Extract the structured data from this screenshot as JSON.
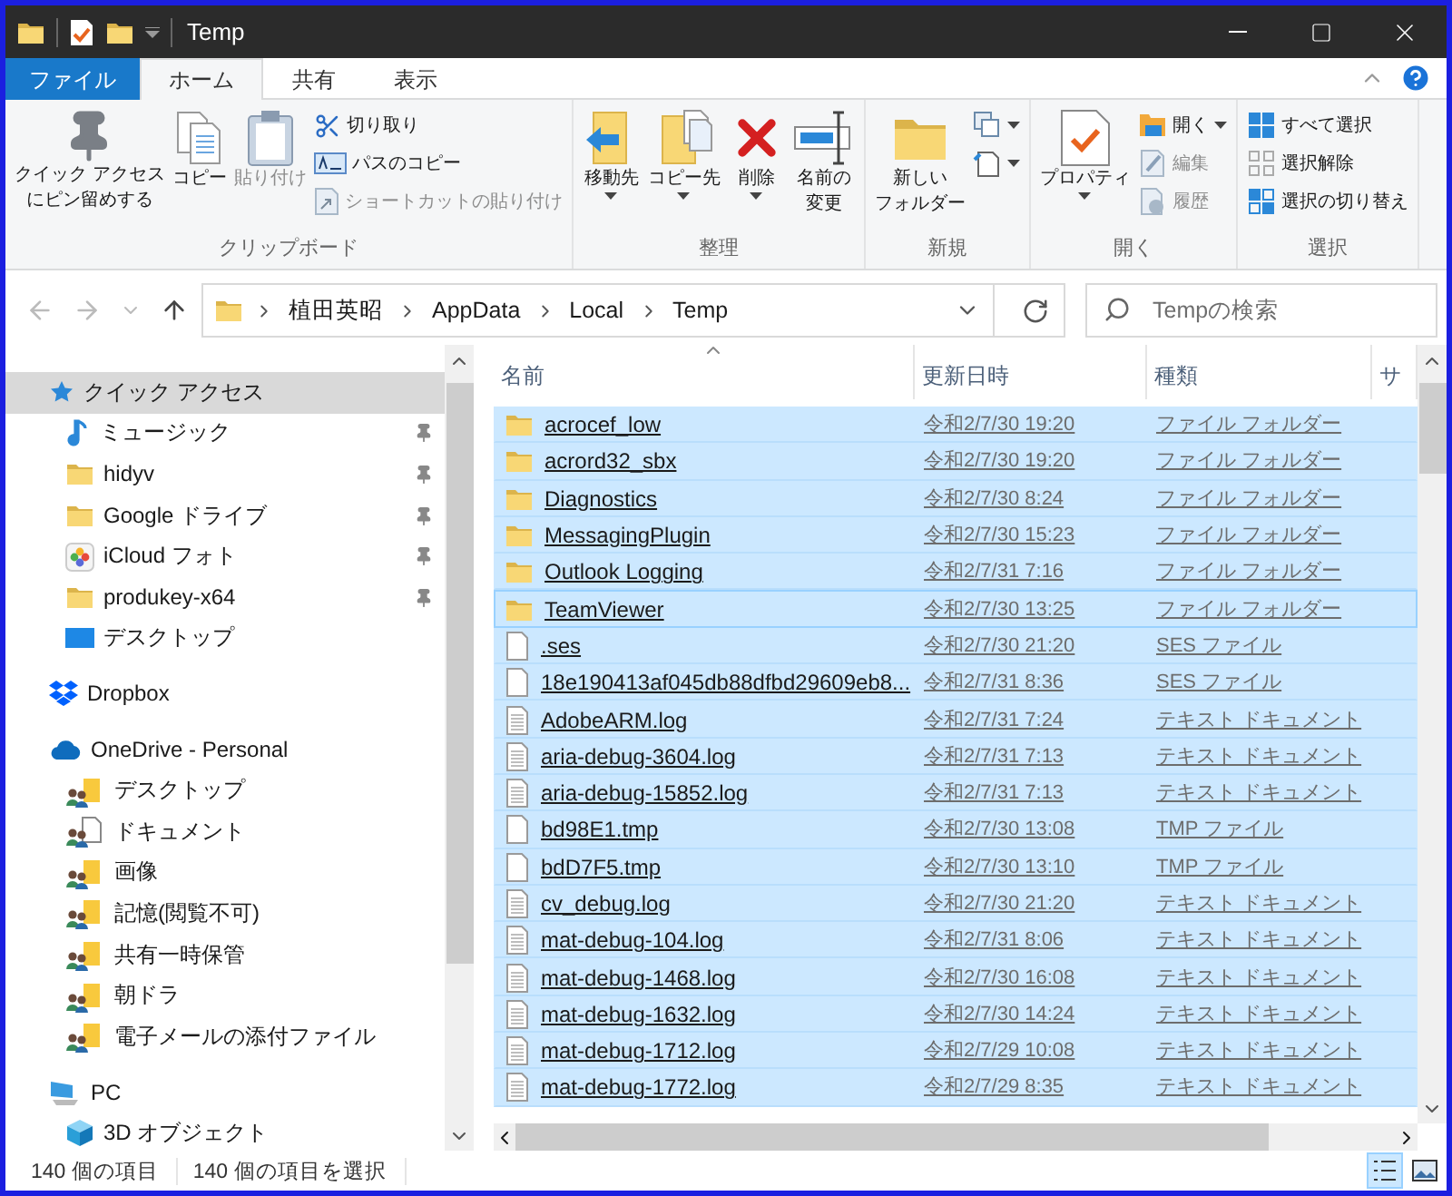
{
  "window": {
    "title": "Temp"
  },
  "ribbon_tabs": [
    {
      "label": "ファイル",
      "kind": "file",
      "selected": false
    },
    {
      "label": "ホーム",
      "kind": "tab",
      "selected": true
    },
    {
      "label": "共有",
      "kind": "tab",
      "selected": false
    },
    {
      "label": "表示",
      "kind": "tab",
      "selected": false
    }
  ],
  "ribbon_groups": [
    {
      "label": "クリップボード",
      "items": [
        {
          "kind": "large",
          "lines": [
            "クイック アクセス",
            "にピン留めする"
          ],
          "disabled": false,
          "dropdown": false
        },
        {
          "kind": "large",
          "lines": [
            "コピー"
          ],
          "disabled": false,
          "dropdown": false
        },
        {
          "kind": "large",
          "lines": [
            "貼り付け"
          ],
          "disabled": true,
          "dropdown": false
        },
        {
          "kind": "small",
          "label": "切り取り",
          "disabled": false,
          "dropdown": false
        },
        {
          "kind": "small",
          "label": "パスのコピー",
          "disabled": false,
          "dropdown": false
        },
        {
          "kind": "small",
          "label": "ショートカットの貼り付け",
          "disabled": true,
          "dropdown": false
        }
      ]
    },
    {
      "label": "整理",
      "items": [
        {
          "kind": "large",
          "lines": [
            "移動先"
          ],
          "disabled": false,
          "dropdown": true
        },
        {
          "kind": "large",
          "lines": [
            "コピー先"
          ],
          "disabled": false,
          "dropdown": true
        },
        {
          "kind": "large",
          "lines": [
            "削除"
          ],
          "disabled": false,
          "dropdown": true
        },
        {
          "kind": "large",
          "lines": [
            "名前の",
            "変更"
          ],
          "disabled": false,
          "dropdown": false
        }
      ]
    },
    {
      "label": "新規",
      "items": [
        {
          "kind": "large",
          "lines": [
            "新しい",
            "フォルダー"
          ],
          "disabled": false,
          "dropdown": false
        },
        {
          "kind": "icon",
          "disabled": false,
          "dropdown": true
        },
        {
          "kind": "icon",
          "disabled": false,
          "dropdown": true
        }
      ]
    },
    {
      "label": "開く",
      "items": [
        {
          "kind": "large",
          "lines": [
            "プロパティ"
          ],
          "disabled": false,
          "dropdown": true
        },
        {
          "kind": "small",
          "label": "開く",
          "disabled": false,
          "dropdown": true
        },
        {
          "kind": "small",
          "label": "編集",
          "disabled": true,
          "dropdown": false
        },
        {
          "kind": "small",
          "label": "履歴",
          "disabled": true,
          "dropdown": false
        }
      ]
    },
    {
      "label": "選択",
      "items": [
        {
          "kind": "small",
          "label": "すべて選択",
          "disabled": false,
          "dropdown": false
        },
        {
          "kind": "small",
          "label": "選択解除",
          "disabled": false,
          "dropdown": false
        },
        {
          "kind": "small",
          "label": "選択の切り替え",
          "disabled": false,
          "dropdown": false
        }
      ]
    }
  ],
  "breadcrumbs": [
    "植田英昭",
    "AppData",
    "Local",
    "Temp"
  ],
  "search": {
    "placeholder": "Tempの検索"
  },
  "sidebar": [
    {
      "label": "クイック アクセス",
      "kind": "star",
      "selected": true,
      "pinned": false,
      "children": [
        {
          "label": "ミュージック",
          "kind": "music",
          "selected": false,
          "pinned": true
        },
        {
          "label": "hidyv",
          "kind": "folder",
          "selected": false,
          "pinned": true
        },
        {
          "label": "Google ドライブ",
          "kind": "folder",
          "selected": false,
          "pinned": true
        },
        {
          "label": "iCloud フォト",
          "kind": "photos",
          "selected": false,
          "pinned": true
        },
        {
          "label": "produkey-x64",
          "kind": "folder",
          "selected": false,
          "pinned": true
        },
        {
          "label": "デスクトップ",
          "kind": "desktop",
          "selected": false,
          "pinned": false
        }
      ]
    },
    {
      "label": "Dropbox",
      "kind": "dropbox",
      "selected": false,
      "pinned": false
    },
    {
      "label": "OneDrive - Personal",
      "kind": "cloud",
      "selected": false,
      "pinned": false,
      "children": [
        {
          "label": "デスクトップ",
          "kind": "shared-folder",
          "selected": false,
          "pinned": false
        },
        {
          "label": "ドキュメント",
          "kind": "shared-doc",
          "selected": false,
          "pinned": false
        },
        {
          "label": "画像",
          "kind": "shared-folder",
          "selected": false,
          "pinned": false
        },
        {
          "label": "記憶(閲覧不可)",
          "kind": "shared-folder",
          "selected": false,
          "pinned": false
        },
        {
          "label": "共有一時保管",
          "kind": "shared-folder",
          "selected": false,
          "pinned": false
        },
        {
          "label": "朝ドラ",
          "kind": "shared-folder",
          "selected": false,
          "pinned": false
        },
        {
          "label": "電子メールの添付ファイル",
          "kind": "shared-folder",
          "selected": false,
          "pinned": false
        }
      ]
    },
    {
      "label": "PC",
      "kind": "pc",
      "selected": false,
      "pinned": false,
      "children": [
        {
          "label": "3D オブジェクト",
          "kind": "cube",
          "selected": false,
          "pinned": false
        }
      ]
    }
  ],
  "table": {
    "columns": [
      "名前",
      "更新日時",
      "種類",
      "サ"
    ],
    "rows": [
      {
        "name": "acrocef_low",
        "date": "令和2/7/30 19:20",
        "type": "ファイル フォルダー",
        "kind": "folder",
        "selected": true,
        "focused": false
      },
      {
        "name": "acrord32_sbx",
        "date": "令和2/7/30 19:20",
        "type": "ファイル フォルダー",
        "kind": "folder",
        "selected": true,
        "focused": false
      },
      {
        "name": "Diagnostics",
        "date": "令和2/7/30 8:24",
        "type": "ファイル フォルダー",
        "kind": "folder",
        "selected": true,
        "focused": false
      },
      {
        "name": "MessagingPlugin",
        "date": "令和2/7/30 15:23",
        "type": "ファイル フォルダー",
        "kind": "folder",
        "selected": true,
        "focused": false
      },
      {
        "name": "Outlook Logging",
        "date": "令和2/7/31 7:16",
        "type": "ファイル フォルダー",
        "kind": "folder",
        "selected": true,
        "focused": false
      },
      {
        "name": "TeamViewer",
        "date": "令和2/7/30 13:25",
        "type": "ファイル フォルダー",
        "kind": "folder",
        "selected": true,
        "focused": true
      },
      {
        "name": ".ses",
        "date": "令和2/7/30 21:20",
        "type": "SES ファイル",
        "kind": "file",
        "selected": true,
        "focused": false
      },
      {
        "name": "18e190413af045db88dfbd29609eb8...",
        "date": "令和2/7/31 8:36",
        "type": "SES ファイル",
        "kind": "file",
        "selected": true,
        "focused": false
      },
      {
        "name": "AdobeARM.log",
        "date": "令和2/7/31 7:24",
        "type": "テキスト ドキュメント",
        "kind": "text",
        "selected": true,
        "focused": false
      },
      {
        "name": "aria-debug-3604.log",
        "date": "令和2/7/31 7:13",
        "type": "テキスト ドキュメント",
        "kind": "text",
        "selected": true,
        "focused": false
      },
      {
        "name": "aria-debug-15852.log",
        "date": "令和2/7/31 7:13",
        "type": "テキスト ドキュメント",
        "kind": "text",
        "selected": true,
        "focused": false
      },
      {
        "name": "bd98E1.tmp",
        "date": "令和2/7/30 13:08",
        "type": "TMP ファイル",
        "kind": "file",
        "selected": true,
        "focused": false
      },
      {
        "name": "bdD7F5.tmp",
        "date": "令和2/7/30 13:10",
        "type": "TMP ファイル",
        "kind": "file",
        "selected": true,
        "focused": false
      },
      {
        "name": "cv_debug.log",
        "date": "令和2/7/30 21:20",
        "type": "テキスト ドキュメント",
        "kind": "text",
        "selected": true,
        "focused": false
      },
      {
        "name": "mat-debug-104.log",
        "date": "令和2/7/31 8:06",
        "type": "テキスト ドキュメント",
        "kind": "text",
        "selected": true,
        "focused": false
      },
      {
        "name": "mat-debug-1468.log",
        "date": "令和2/7/30 16:08",
        "type": "テキスト ドキュメント",
        "kind": "text",
        "selected": true,
        "focused": false
      },
      {
        "name": "mat-debug-1632.log",
        "date": "令和2/7/30 14:24",
        "type": "テキスト ドキュメント",
        "kind": "text",
        "selected": true,
        "focused": false
      },
      {
        "name": "mat-debug-1712.log",
        "date": "令和2/7/29 10:08",
        "type": "テキスト ドキュメント",
        "kind": "text",
        "selected": true,
        "focused": false
      },
      {
        "name": "mat-debug-1772.log",
        "date": "令和2/7/29 8:35",
        "type": "テキスト ドキュメント",
        "kind": "text",
        "selected": true,
        "focused": false
      }
    ]
  },
  "status_bar": [
    "140 個の項目",
    "140 個の項目を選択"
  ],
  "view_buttons": [
    {
      "kind": "details",
      "selected": true
    },
    {
      "kind": "large-icons",
      "selected": false
    }
  ]
}
